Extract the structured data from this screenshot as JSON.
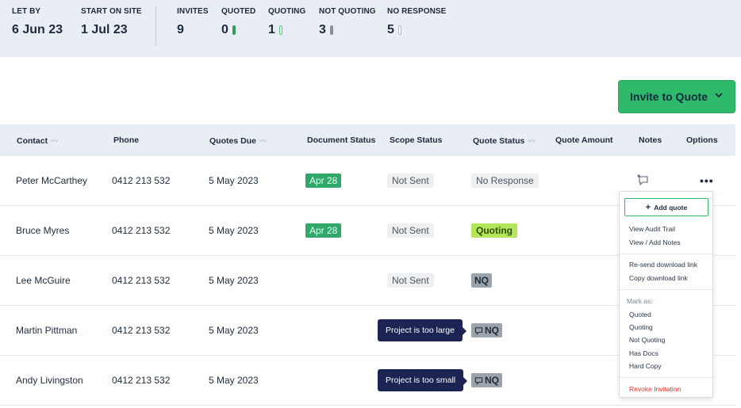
{
  "summary": {
    "let_by": {
      "label": "LET BY",
      "value": "6 Jun 23"
    },
    "start_on_site": {
      "label": "START ON SITE",
      "value": "1 Jul 23"
    },
    "invites": {
      "label": "INVITES",
      "value": "9"
    },
    "quoted": {
      "label": "QUOTED",
      "value": "0"
    },
    "quoting": {
      "label": "QUOTING",
      "value": "1"
    },
    "not_quoting": {
      "label": "NOT QUOTING",
      "value": "3"
    },
    "no_response": {
      "label": "NO RESPONSE",
      "value": "5"
    }
  },
  "invite_button": {
    "label": "Invite to Quote",
    "icon": "chevron-down-icon"
  },
  "table": {
    "headers": {
      "contact": "Contact",
      "phone": "Phone",
      "quotes_due": "Quotes Due",
      "document_status": "Document Status",
      "scope_status": "Scope Status",
      "quote_status": "Quote Status",
      "quote_amount": "Quote Amount",
      "notes": "Notes",
      "options": "Options"
    },
    "rows": [
      {
        "contact": "Peter  McCarthey",
        "phone": "0412 213 532",
        "due": "5 May 2023",
        "doc": "Apr 28",
        "scope": "Not Sent",
        "quote_status": "No Response"
      },
      {
        "contact": "Bruce Myres",
        "phone": "0412 213 532",
        "due": "5 May 2023",
        "doc": "Apr 28",
        "scope": "Not Sent",
        "quote_status": "Quoting"
      },
      {
        "contact": "Lee McGuire",
        "phone": "0412 213 532",
        "due": "5 May 2023",
        "doc": "",
        "scope": "Not Sent",
        "quote_status": "NQ"
      },
      {
        "contact": "Martin Pittman",
        "phone": "0412 213 532",
        "due": "5 May 2023",
        "doc": "",
        "scope": "",
        "quote_status": "NQ",
        "tooltip": "Project is too large"
      },
      {
        "contact": "Andy Livingston",
        "phone": "0412 213 532",
        "due": "5 May 2023",
        "doc": "",
        "scope": "",
        "quote_status": "NQ",
        "tooltip": "Project is too small"
      }
    ]
  },
  "menu": {
    "add_quote": "Add quote",
    "view_audit_trail": "View Audit Trail",
    "view_add_notes": "View / Add Notes",
    "resend_link": "Re-send download link",
    "copy_link": "Copy download link",
    "mark_as": "Mark as:",
    "quoted": "Quoted",
    "quoting": "Quoting",
    "not_quoting": "Not Quoting",
    "has_docs": "Has Docs",
    "hard_copy": "Hard Copy",
    "revoke": "Revoke Invitation"
  },
  "colors": {
    "accent_green": "#2fb96a",
    "header_bg": "#e8eef4",
    "tooltip_bg": "#1b2452",
    "quoting_badge": "#b4e65a",
    "revoke_red": "#e0362c"
  }
}
